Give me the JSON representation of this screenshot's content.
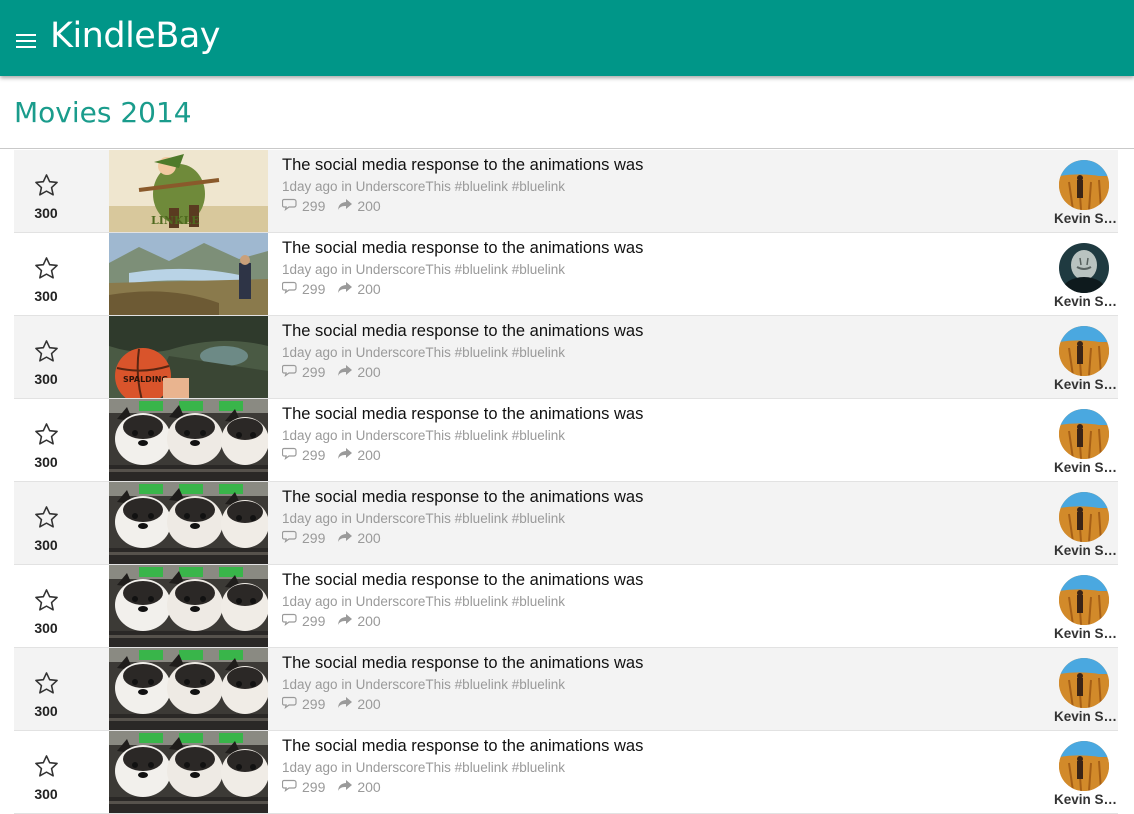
{
  "app": {
    "brand": "KindleBay",
    "menu_icon": "hamburger-icon",
    "accent": "#009688"
  },
  "page": {
    "title": "Movies 2014"
  },
  "posts": [
    {
      "votes": "300",
      "thumb": "elf-warrior",
      "title": "The social media response to the animations was",
      "time": "1day ago",
      "in_word": "in",
      "source": "UnderscoreThis",
      "tags": [
        "#bluelink",
        "#bluelink"
      ],
      "comments": "299",
      "shares": "200",
      "avatar": "wheat-field",
      "author": "Kevin Smith"
    },
    {
      "votes": "300",
      "thumb": "mountain-lake",
      "title": "The social media response to the animations was",
      "time": "1day ago",
      "in_word": "in",
      "source": "UnderscoreThis",
      "tags": [
        "#bluelink",
        "#bluelink"
      ],
      "comments": "299",
      "shares": "200",
      "avatar": "dark-figure",
      "author": "Kevin Smith"
    },
    {
      "votes": "300",
      "thumb": "basketball-canyon",
      "title": "The social media response to the animations was",
      "time": "1day ago",
      "in_word": "in",
      "source": "UnderscoreThis",
      "tags": [
        "#bluelink",
        "#bluelink"
      ],
      "comments": "299",
      "shares": "200",
      "avatar": "wheat-field",
      "author": "Kevin Smith"
    },
    {
      "votes": "300",
      "thumb": "husky-puppies",
      "title": "The social media response to the animations was",
      "time": "1day ago",
      "in_word": "in",
      "source": "UnderscoreThis",
      "tags": [
        "#bluelink",
        "#bluelink"
      ],
      "comments": "299",
      "shares": "200",
      "avatar": "wheat-field",
      "author": "Kevin Smith"
    },
    {
      "votes": "300",
      "thumb": "husky-puppies",
      "title": "The social media response to the animations was",
      "time": "1day ago",
      "in_word": "in",
      "source": "UnderscoreThis",
      "tags": [
        "#bluelink",
        "#bluelink"
      ],
      "comments": "299",
      "shares": "200",
      "avatar": "wheat-field",
      "author": "Kevin Smith"
    },
    {
      "votes": "300",
      "thumb": "husky-puppies",
      "title": "The social media response to the animations was",
      "time": "1day ago",
      "in_word": "in",
      "source": "UnderscoreThis",
      "tags": [
        "#bluelink",
        "#bluelink"
      ],
      "comments": "299",
      "shares": "200",
      "avatar": "wheat-field",
      "author": "Kevin Smith"
    },
    {
      "votes": "300",
      "thumb": "husky-puppies",
      "title": "The social media response to the animations was",
      "time": "1day ago",
      "in_word": "in",
      "source": "UnderscoreThis",
      "tags": [
        "#bluelink",
        "#bluelink"
      ],
      "comments": "299",
      "shares": "200",
      "avatar": "wheat-field",
      "author": "Kevin Smith"
    },
    {
      "votes": "300",
      "thumb": "husky-puppies",
      "title": "The social media response to the animations was",
      "time": "1day ago",
      "in_word": "in",
      "source": "UnderscoreThis",
      "tags": [
        "#bluelink",
        "#bluelink"
      ],
      "comments": "299",
      "shares": "200",
      "avatar": "wheat-field",
      "author": "Kevin Smith"
    }
  ]
}
